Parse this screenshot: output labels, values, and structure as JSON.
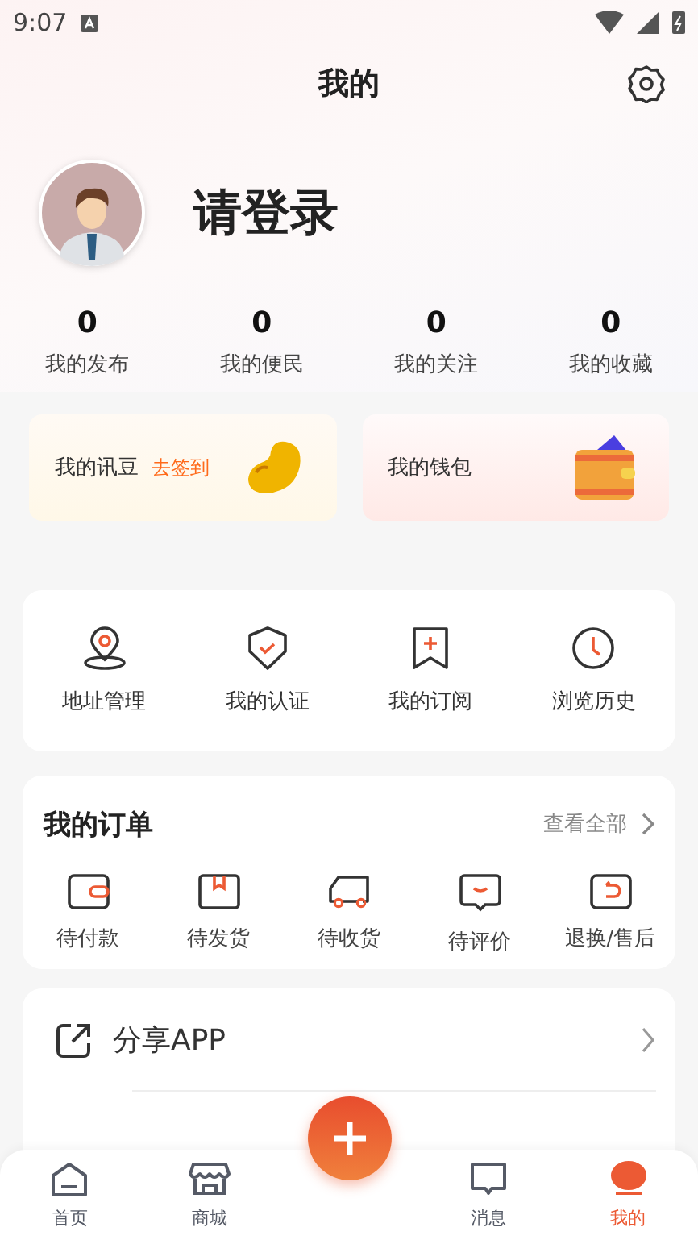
{
  "status_bar": {
    "time": "9:07"
  },
  "header": {
    "title": "我的"
  },
  "profile": {
    "login_prompt": "请登录"
  },
  "stats": [
    {
      "value": "0",
      "label": "我的发布"
    },
    {
      "value": "0",
      "label": "我的便民"
    },
    {
      "value": "0",
      "label": "我的关注"
    },
    {
      "value": "0",
      "label": "我的收藏"
    }
  ],
  "cards": [
    {
      "kind": "beans",
      "label": "我的讯豆",
      "action": "去签到"
    },
    {
      "kind": "wallet",
      "label": "我的钱包"
    }
  ],
  "services": [
    {
      "kind": "location",
      "label": "地址管理"
    },
    {
      "kind": "shield",
      "label": "我的认证"
    },
    {
      "kind": "bookmark",
      "label": "我的订阅"
    },
    {
      "kind": "clock",
      "label": "浏览历史"
    }
  ],
  "orders": {
    "title": "我的订单",
    "view_all": "查看全部",
    "items": [
      {
        "kind": "payment",
        "label": "待付款"
      },
      {
        "kind": "box",
        "label": "待发货"
      },
      {
        "kind": "truck",
        "label": "待收货"
      },
      {
        "kind": "review",
        "label": "待评价"
      },
      {
        "kind": "return",
        "label": "退换/售后"
      }
    ]
  },
  "menu": [
    {
      "kind": "share",
      "label": "分享APP"
    }
  ],
  "nav": [
    {
      "kind": "home",
      "label": "首页",
      "selected": false
    },
    {
      "kind": "shop",
      "label": "商城",
      "selected": false
    },
    {
      "kind": "message",
      "label": "消息",
      "selected": false
    },
    {
      "kind": "me",
      "label": "我的",
      "selected": true
    }
  ]
}
